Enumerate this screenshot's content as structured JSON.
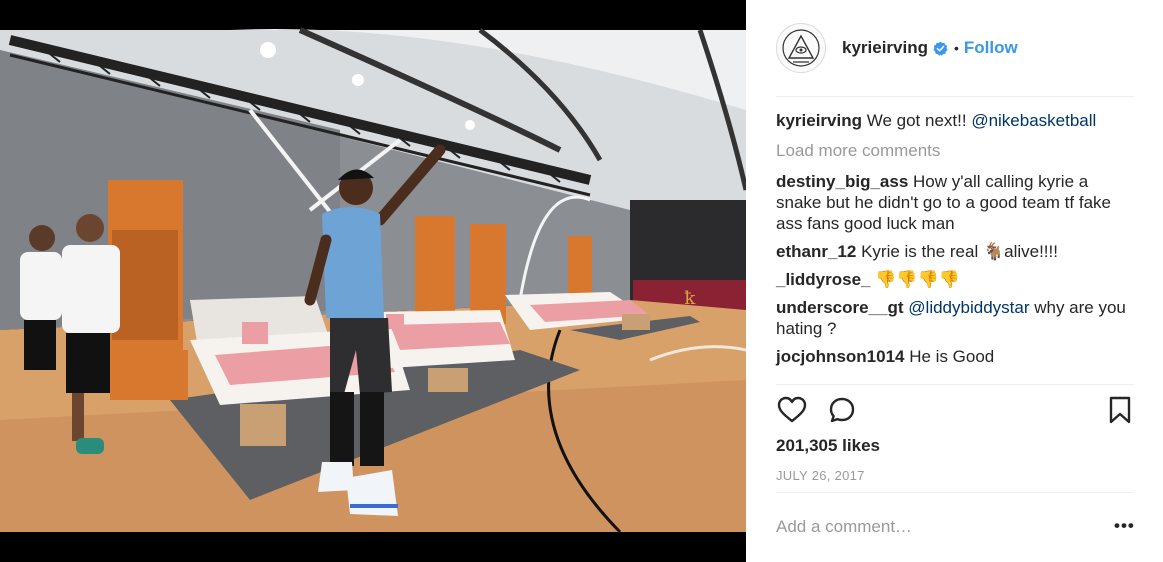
{
  "post": {
    "image_alt": "Kyrie Irving pointing upward in a basketball gym furnished with beds and orange lockers",
    "header": {
      "username": "kyrieirving",
      "separator": "•",
      "follow_label": "Follow",
      "avatar_icon": "eye-pyramid-logo-icon"
    },
    "caption": {
      "username": "kyrieirving",
      "text": "We got next!! ",
      "mention": "@nikebasketball"
    },
    "load_more_label": "Load more comments",
    "comments": [
      {
        "username": "destiny_big_ass",
        "text": "How y'all calling kyrie a snake but he didn't go to a good team tf fake ass fans good luck man"
      },
      {
        "username": "ethanr_12",
        "text": "Kyrie is the real 🐐alive!!!!"
      },
      {
        "username": "_liddyrose_",
        "text": "👎👎👎👎"
      },
      {
        "username": "underscore__gt",
        "mention": "@liddybiddystar",
        "text": " why are you hating ?"
      },
      {
        "username": "jocjohnson1014",
        "text": "He is Good"
      }
    ],
    "likes_label": "201,305 likes",
    "date_label": "JULY 26, 2017",
    "add_comment_placeholder": "Add a comment…",
    "more_options_label": "•••",
    "icons": {
      "like": "heart-icon",
      "comment": "comment-bubble-icon",
      "save": "bookmark-icon",
      "verified": "verified-badge-icon"
    },
    "colors": {
      "link_blue": "#3897f0",
      "mention_blue": "#003569",
      "muted": "#999999",
      "text": "#262626"
    }
  }
}
